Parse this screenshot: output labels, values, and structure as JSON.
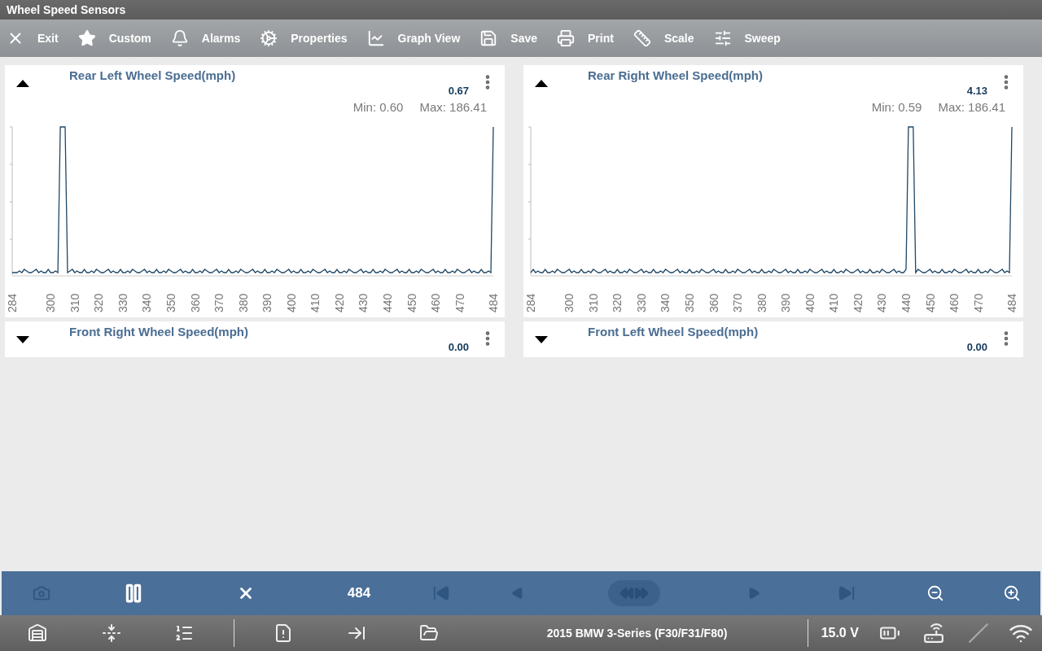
{
  "window": {
    "title": "Wheel Speed Sensors"
  },
  "toolbar": [
    "Exit",
    "Custom",
    "Alarms",
    "Properties",
    "Graph View",
    "Save",
    "Print",
    "Scale",
    "Sweep"
  ],
  "panels": [
    {
      "title": "Rear Left Wheel Speed(mph)",
      "value": "0.67",
      "expanded": true,
      "min": "Min: 0.60",
      "max": "Max: 186.41",
      "x_labels": [
        "284",
        "300",
        "310",
        "320",
        "330",
        "340",
        "350",
        "360",
        "370",
        "380",
        "390",
        "400",
        "410",
        "420",
        "430",
        "440",
        "450",
        "460",
        "470",
        "484"
      ]
    },
    {
      "title": "Rear Right Wheel Speed(mph)",
      "value": "4.13",
      "expanded": true,
      "min": "Min: 0.59",
      "max": "Max: 186.41",
      "x_labels": [
        "284",
        "300",
        "310",
        "320",
        "330",
        "340",
        "350",
        "360",
        "370",
        "380",
        "390",
        "400",
        "410",
        "420",
        "430",
        "440",
        "450",
        "460",
        "470",
        "484"
      ]
    },
    {
      "title": "Front Right Wheel Speed(mph)",
      "value": "0.00",
      "expanded": false
    },
    {
      "title": "Front Left Wheel Speed(mph)",
      "value": "0.00",
      "expanded": false
    }
  ],
  "playback": [
    {
      "kind": "camera",
      "disabled": true
    },
    {
      "kind": "pause",
      "disabled": false
    },
    {
      "kind": "stop",
      "disabled": false
    },
    {
      "kind": "position",
      "text": "484"
    },
    {
      "kind": "first",
      "disabled": true
    },
    {
      "kind": "prev",
      "disabled": true
    },
    {
      "kind": "scrub",
      "disabled": true
    },
    {
      "kind": "next",
      "disabled": true
    },
    {
      "kind": "last",
      "disabled": true
    },
    {
      "kind": "zoom-out",
      "disabled": false
    },
    {
      "kind": "zoom-in",
      "disabled": false
    }
  ],
  "status_bar": {
    "vehicle": "2015 BMW 3-Series (F30/F31/F80)",
    "voltage": "15.0 V"
  }
}
